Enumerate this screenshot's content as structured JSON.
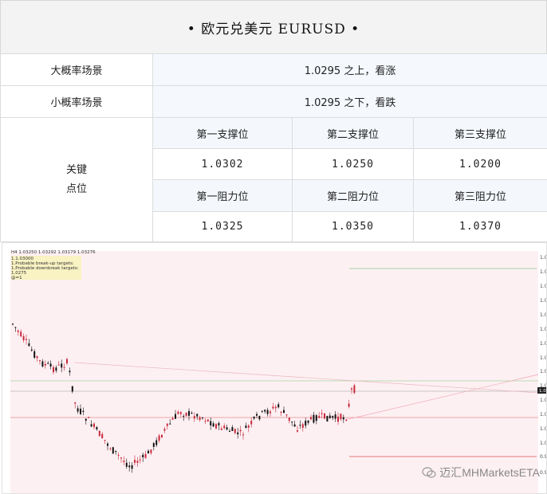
{
  "header": {
    "title": "•  欧元兑美元   EURUSD   •"
  },
  "scenarios": {
    "big": {
      "label": "大概率场景",
      "value": "1.0295 之上，看涨"
    },
    "small": {
      "label": "小概率场景",
      "value": "1.0295 之下，看跌"
    }
  },
  "levels": {
    "label_line1": "关键",
    "label_line2": "点位",
    "support_headers": [
      "第一支撑位",
      "第二支撑位",
      "第三支撑位"
    ],
    "support_values": [
      "1.0302",
      "1.0250",
      "1.0200"
    ],
    "resistance_headers": [
      "第一阻力位",
      "第二阻力位",
      "第三阻力位"
    ],
    "resistance_values": [
      "1.0325",
      "1.0350",
      "1.0370"
    ]
  },
  "chart": {
    "header_line": "H4  1.03250 1.03292 1.03179 1.03276",
    "info_lines": [
      "1.1.03000",
      "1.Probable break-up targets:",
      "1.Probable downbreak targets:",
      "1.0275",
      "@=1"
    ],
    "price_tag": "1.0",
    "y_axis_labels": [
      "1.0",
      "1.0",
      "1.0",
      "1.0",
      "1.0",
      "1.0",
      "1.0",
      "1.0",
      "1.0",
      "1.0",
      "1.0",
      "1.0",
      "1.0",
      "1.0",
      "0.9",
      "0.9"
    ],
    "colors": {
      "bull": "#c8283a",
      "bear": "#111111",
      "background": "#fdf0f3"
    }
  },
  "watermark": {
    "text": "迈汇MHMarketsETA"
  }
}
